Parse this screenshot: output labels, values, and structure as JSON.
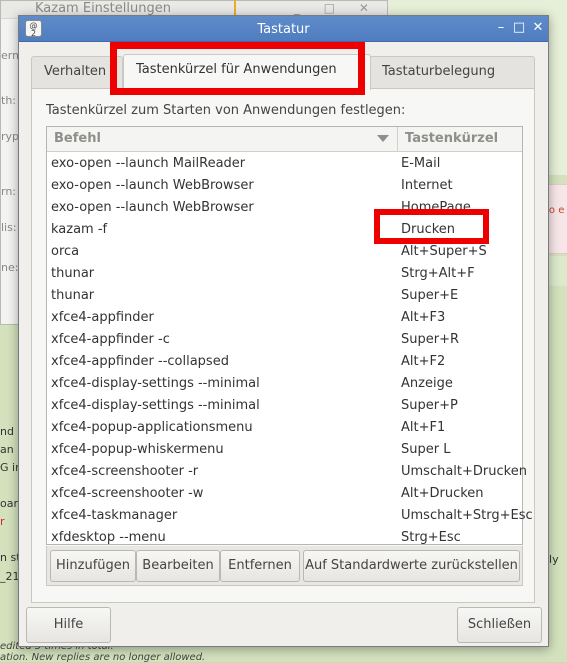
{
  "background": {
    "kazam_title": "Kazam Einstellungen",
    "kazam_controls": "_ □ ✕",
    "kazam_labels": [
      "erm",
      "th:",
      "ryp",
      "rn:",
      "lis:",
      "ne:"
    ],
    "left_fragments": [
      "nd",
      "an",
      "G in",
      "oar",
      "r",
      "n st",
      "_21"
    ],
    "right_fragments": [
      "lly"
    ],
    "pink_text": "to e",
    "bottom_fragments": [
      "edited 3 times in total.",
      "ation. New replies are no longer allowed."
    ]
  },
  "dialog": {
    "title": "Tastatur",
    "icon_text": "@\n2",
    "controls": {
      "minimize": "–",
      "maximize": "□",
      "close": "✕"
    }
  },
  "tabs": [
    {
      "label": "Verhalten",
      "active": false
    },
    {
      "label": "Tastenkürzel für Anwendungen",
      "active": true
    },
    {
      "label": "Tastaturbelegung",
      "active": false
    }
  ],
  "page": {
    "description": "Tastenkürzel zum Starten von Anwendungen festlegen:",
    "columns": {
      "command": "Befehl",
      "shortcut": "Tastenkürzel"
    }
  },
  "shortcuts": [
    {
      "command": "exo-open --launch MailReader",
      "shortcut": "E-Mail"
    },
    {
      "command": "exo-open --launch WebBrowser",
      "shortcut": "Internet"
    },
    {
      "command": "exo-open --launch WebBrowser",
      "shortcut": "HomePage"
    },
    {
      "command": "kazam -f",
      "shortcut": "Drucken"
    },
    {
      "command": "orca",
      "shortcut": "Alt+Super+S"
    },
    {
      "command": "thunar",
      "shortcut": "Strg+Alt+F"
    },
    {
      "command": "thunar",
      "shortcut": "Super+E"
    },
    {
      "command": "xfce4-appfinder",
      "shortcut": "Alt+F3"
    },
    {
      "command": "xfce4-appfinder -c",
      "shortcut": "Super+R"
    },
    {
      "command": "xfce4-appfinder --collapsed",
      "shortcut": "Alt+F2"
    },
    {
      "command": "xfce4-display-settings --minimal",
      "shortcut": "Anzeige"
    },
    {
      "command": "xfce4-display-settings --minimal",
      "shortcut": "Super+P"
    },
    {
      "command": "xfce4-popup-applicationsmenu",
      "shortcut": "Alt+F1"
    },
    {
      "command": "xfce4-popup-whiskermenu",
      "shortcut": "Super L"
    },
    {
      "command": "xfce4-screenshooter -r",
      "shortcut": "Umschalt+Drucken"
    },
    {
      "command": "xfce4-screenshooter -w",
      "shortcut": "Alt+Drucken"
    },
    {
      "command": "xfce4-taskmanager",
      "shortcut": "Umschalt+Strg+Esc"
    },
    {
      "command": "xfdesktop --menu",
      "shortcut": "Strg+Esc"
    }
  ],
  "buttons": {
    "add": "Hinzufügen",
    "edit": "Bearbeiten",
    "remove": "Entfernen",
    "reset": "Auf Standardwerte zurückstellen",
    "help": "Hilfe",
    "close": "Schließen"
  },
  "colors": {
    "titlebar": "#5f8bc9",
    "annotation": "#ee0000"
  }
}
